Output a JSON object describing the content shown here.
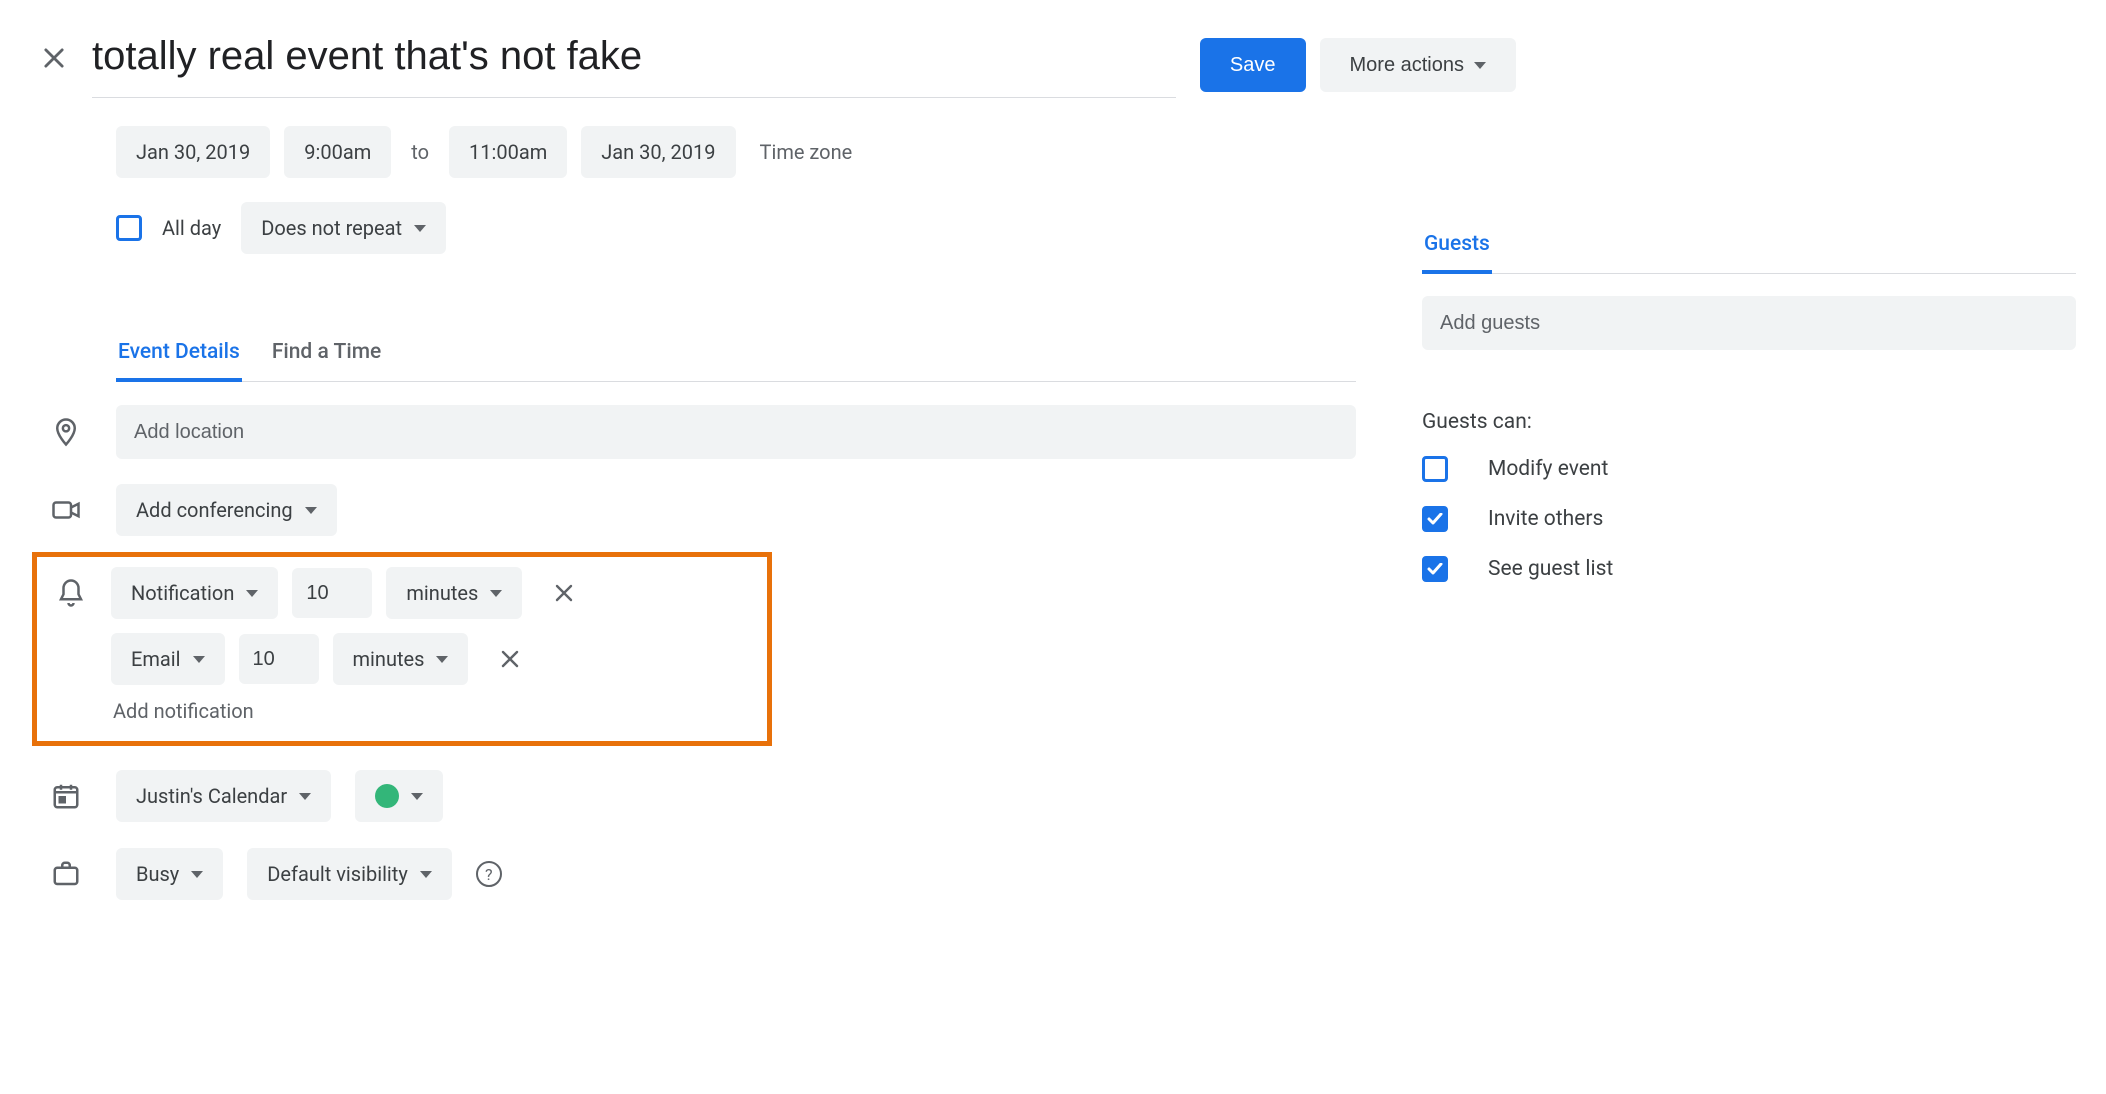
{
  "header": {
    "title": "totally real event that's not fake",
    "save_label": "Save",
    "more_actions_label": "More actions"
  },
  "datetime": {
    "start_date": "Jan 30, 2019",
    "start_time": "9:00am",
    "to_label": "to",
    "end_time": "11:00am",
    "end_date": "Jan 30, 2019",
    "timezone_label": "Time zone",
    "all_day_label": "All day",
    "all_day_checked": false,
    "repeat_label": "Does not repeat"
  },
  "tabs": {
    "event_details": "Event Details",
    "find_time": "Find a Time"
  },
  "location": {
    "placeholder": "Add location",
    "value": ""
  },
  "conferencing": {
    "label": "Add conferencing"
  },
  "notifications": {
    "rows": [
      {
        "type": "Notification",
        "amount": "10",
        "unit": "minutes"
      },
      {
        "type": "Email",
        "amount": "10",
        "unit": "minutes"
      }
    ],
    "add_label": "Add notification"
  },
  "calendar": {
    "name": "Justin's Calendar",
    "color": "#33b679"
  },
  "availability": {
    "busy": "Busy",
    "visibility": "Default visibility"
  },
  "guests": {
    "tab_label": "Guests",
    "placeholder": "Add guests",
    "permissions_title": "Guests can:",
    "permissions": [
      {
        "label": "Modify event",
        "checked": false
      },
      {
        "label": "Invite others",
        "checked": true
      },
      {
        "label": "See guest list",
        "checked": true
      }
    ]
  }
}
